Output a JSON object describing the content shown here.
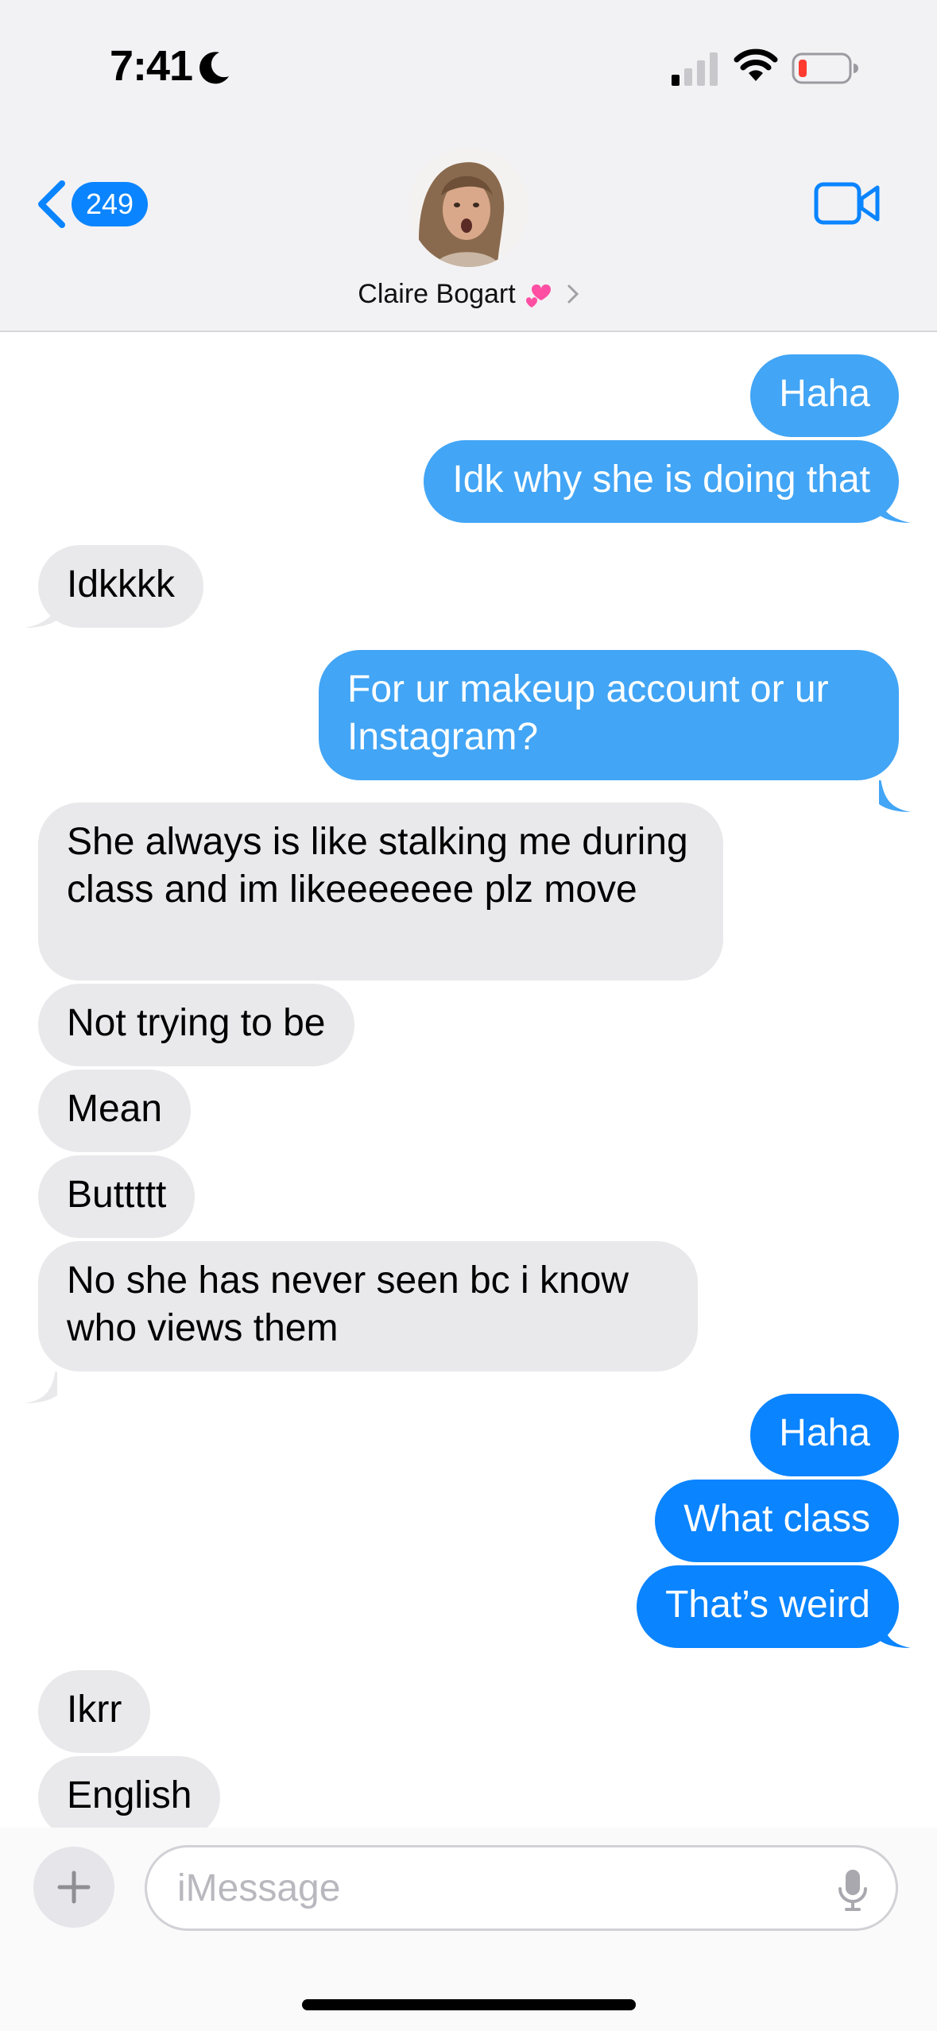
{
  "status_bar": {
    "time": "7:41"
  },
  "header": {
    "back_count": "249",
    "contact_name": "Claire Bogart"
  },
  "messages": [
    {
      "dir": "out",
      "text": "Haha"
    },
    {
      "dir": "out",
      "text": "Idk why she is doing that"
    },
    {
      "dir": "in",
      "text": "Idkkkk"
    },
    {
      "dir": "out",
      "text": "For ur makeup account or ur Instagram?"
    },
    {
      "dir": "in",
      "text": "She always is like stalking me during class and im likeeeeeee plz move"
    },
    {
      "dir": "in",
      "text": "Not trying to be"
    },
    {
      "dir": "in",
      "text": "Mean"
    },
    {
      "dir": "in",
      "text": "Buttttt"
    },
    {
      "dir": "in",
      "text": "No she has never seen bc i know who views them"
    },
    {
      "dir": "out",
      "text": "Haha"
    },
    {
      "dir": "out",
      "text": "What class"
    },
    {
      "dir": "out",
      "text": "That’s weird"
    },
    {
      "dir": "in",
      "text": "Ikrr"
    },
    {
      "dir": "in",
      "text": "English"
    }
  ],
  "composer": {
    "placeholder": "iMessage"
  },
  "colors": {
    "accent": "#0a84ff",
    "incoming": "#e9e9eb",
    "battery_low": "#ff3b30"
  }
}
